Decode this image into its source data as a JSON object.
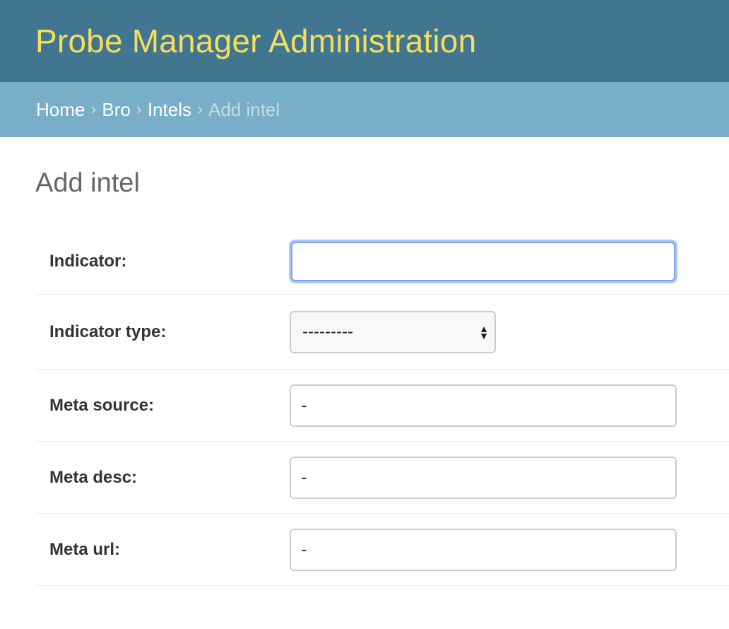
{
  "header": {
    "title": "Probe Manager Administration"
  },
  "breadcrumbs": {
    "items": [
      "Home",
      "Bro",
      "Intels"
    ],
    "separator": "›",
    "current": "Add intel"
  },
  "page": {
    "title": "Add intel"
  },
  "form": {
    "indicator": {
      "label": "Indicator:",
      "value": ""
    },
    "indicator_type": {
      "label": "Indicator type:",
      "selected": "---------"
    },
    "meta_source": {
      "label": "Meta source:",
      "value": "-"
    },
    "meta_desc": {
      "label": "Meta desc:",
      "value": "-"
    },
    "meta_url": {
      "label": "Meta url:",
      "value": "-"
    }
  },
  "colors": {
    "header_bg": "#417690",
    "title_color": "#f5dd5d",
    "breadcrumb_bg": "#79aec8"
  }
}
